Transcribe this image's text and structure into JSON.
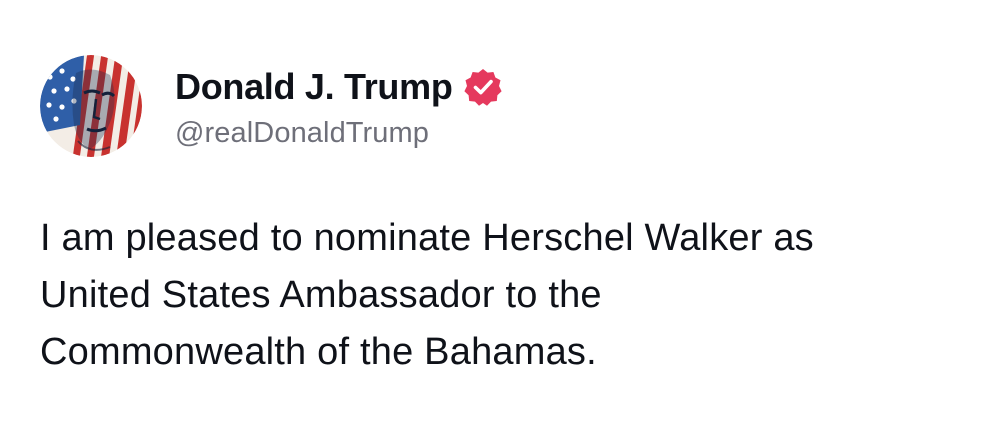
{
  "post": {
    "author": {
      "display_name": "Donald J. Trump",
      "handle": "@realDonaldTrump",
      "verified_icon": "verified-badge-icon",
      "avatar_icon": "flag-portrait-avatar"
    },
    "text": "I am pleased to nominate Herschel Walker as\nUnited States Ambassador to the\nCommonwealth of the Bahamas."
  },
  "colors": {
    "text": "#0f1219",
    "handle": "#6e6f79",
    "verified": "#e5395d",
    "flag_red": "#c8322f",
    "flag_blue": "#2f5fa8"
  }
}
